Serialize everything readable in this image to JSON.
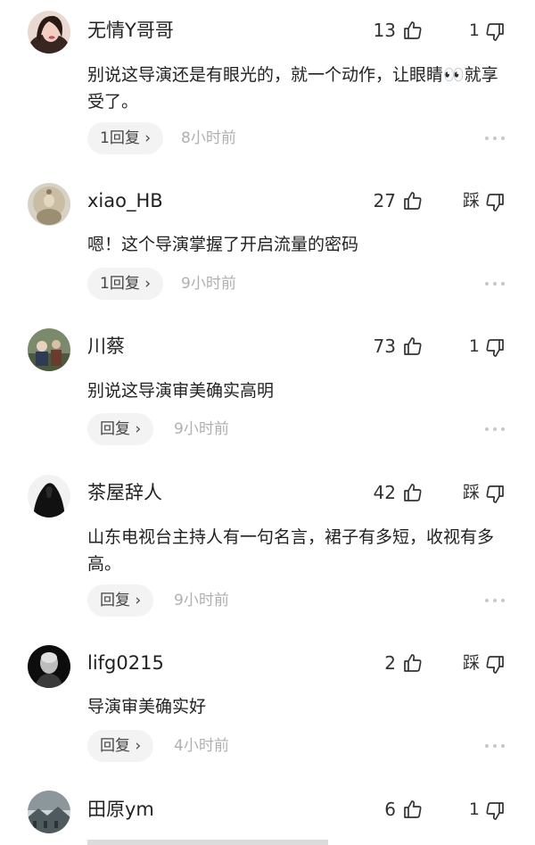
{
  "comments": [
    {
      "username": "无情Y哥哥",
      "likes": "13",
      "dislike_label": "1",
      "text": "别说这导演还是有眼光的，就一个动作，让眼睛👀就享受了。",
      "reply_label": "1回复 ›",
      "time": "8小时前",
      "avatar_icon": "avatar-woman-icon"
    },
    {
      "username": "xiao_HB",
      "likes": "27",
      "dislike_label": "踩",
      "text": "嗯！这个导演掌握了开启流量的密码",
      "reply_label": "1回复 ›",
      "time": "9小时前",
      "avatar_icon": "avatar-buddha-icon"
    },
    {
      "username": "川蔡",
      "likes": "73",
      "dislike_label": "1",
      "text": "别说这导演审美确实高明",
      "reply_label": "回复 ›",
      "time": "9小时前",
      "avatar_icon": "avatar-group-photo-icon"
    },
    {
      "username": "茶屋辞人",
      "likes": "42",
      "dislike_label": "踩",
      "text": "山东电视台主持人有一句名言，裙子有多短，收视有多高。",
      "reply_label": "回复 ›",
      "time": "9小时前",
      "avatar_icon": "avatar-hooded-figure-icon"
    },
    {
      "username": "lifg0215",
      "likes": "2",
      "dislike_label": "踩",
      "text": "导演审美确实好",
      "reply_label": "回复 ›",
      "time": "4小时前",
      "avatar_icon": "avatar-bald-man-icon"
    },
    {
      "username": "田原ym",
      "likes": "6",
      "dislike_label": "1",
      "text": "",
      "reply_label": "",
      "time": "",
      "avatar_icon": "avatar-landscape-icon"
    }
  ],
  "icons": {
    "like": "thumbs-up-icon",
    "dislike": "thumbs-down-icon",
    "more": "more-dots-icon"
  },
  "colors": {
    "text": "#222222",
    "muted": "#b0b0b0",
    "pill_bg": "#f3f3f3"
  }
}
